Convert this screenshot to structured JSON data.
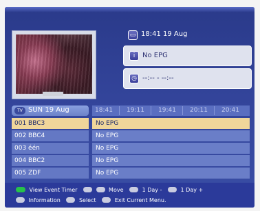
{
  "now": {
    "time": "18:41 19 Aug"
  },
  "current_event": {
    "title": "No EPG"
  },
  "next_event": {
    "time": "--:-- - --:--"
  },
  "guide": {
    "date": "SUN 19 Aug",
    "times": [
      "18:41",
      "19:11",
      "19:41",
      "20:11",
      "20:41"
    ],
    "rows": [
      {
        "channel": "001 BBC3",
        "program": "No EPG",
        "selected": true
      },
      {
        "channel": "002 BBC4",
        "program": "No EPG",
        "selected": false
      },
      {
        "channel": "003 één",
        "program": "No EPG",
        "selected": false
      },
      {
        "channel": "004 BBC2",
        "program": "No EPG",
        "selected": false
      },
      {
        "channel": "005 ZDF",
        "program": "No EPG",
        "selected": false
      }
    ]
  },
  "help": {
    "view_event_timer": "View Event Timer",
    "move": "Move",
    "day_minus": "1 Day -",
    "day_plus": "1 Day +",
    "information": "Information",
    "select": "Select",
    "exit": "Exit Current Menu."
  },
  "icons": {
    "tv": "tv-icon",
    "info": "info-icon",
    "clock": "clock-icon",
    "green_key": "green-button-icon"
  }
}
